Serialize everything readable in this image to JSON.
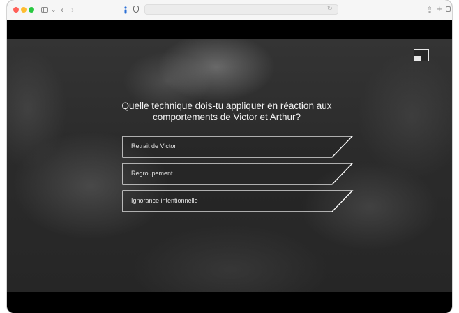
{
  "browser": {
    "url": "",
    "controls": [
      "sidebar-icon",
      "chevron-down-icon",
      "back-icon",
      "forward-icon",
      "share-icon",
      "plus-icon",
      "tabs-icon"
    ]
  },
  "quiz": {
    "question": "Quelle technique dois-tu appliquer en réaction aux\ncomportements de Victor et Arthur?",
    "answers": [
      {
        "label": "Retrait de Victor"
      },
      {
        "label": "Regroupement"
      },
      {
        "label": "Ignorance intentionnelle"
      }
    ]
  },
  "icons": {
    "fullscreen": "expand-icon"
  },
  "colors": {
    "accent": "#ffffff",
    "background": "#2e2e2e",
    "bars": "#000000"
  }
}
